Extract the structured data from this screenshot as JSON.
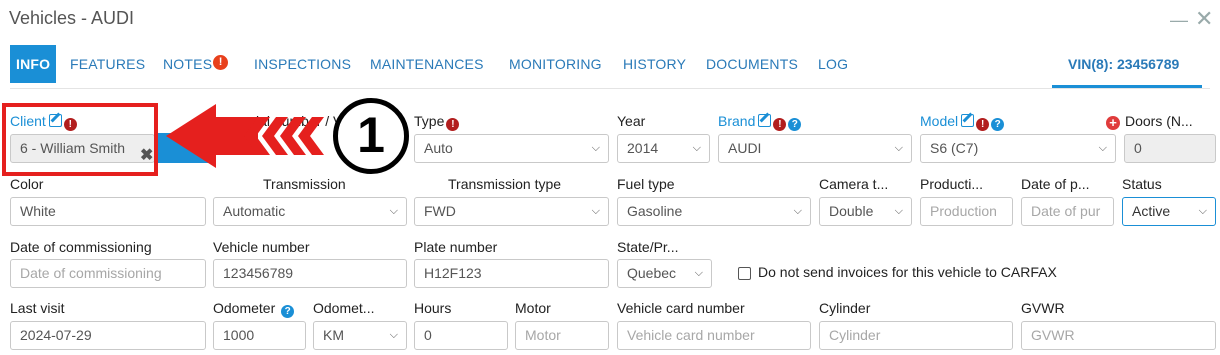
{
  "window": {
    "title": "Vehicles - AUDI",
    "minimize": "—",
    "close": "✕"
  },
  "tabs": [
    {
      "label": "INFO",
      "active": true
    },
    {
      "label": "FEATURES"
    },
    {
      "label": "NOTES",
      "badge": "!"
    },
    {
      "label": "INSPECTIONS"
    },
    {
      "label": "MAINTENANCES"
    },
    {
      "label": "MONITORING"
    },
    {
      "label": "HISTORY"
    },
    {
      "label": "DOCUMENTS"
    },
    {
      "label": "LOG"
    }
  ],
  "vin_tab": "VIN(8): 23456789",
  "icons": {
    "required": "!",
    "help": "?",
    "add": "+",
    "remove": "✖",
    "chevron": "⌵"
  },
  "labels": {
    "client": "Client",
    "serial": "ial number / VI",
    "type": "Type",
    "year": "Year",
    "brand": "Brand",
    "model": "Model",
    "doors": "Doors (N...",
    "color": "Color",
    "transmission": "Transmission",
    "transmission_type": "Transmission type",
    "fuel_type": "Fuel type",
    "camera": "Camera t...",
    "production": "Producti...",
    "date_purchase": "Date of p...",
    "status": "Status",
    "date_commissioning": "Date of commissioning",
    "vehicle_number": "Vehicle number",
    "plate_number": "Plate number",
    "state": "State/Pr...",
    "last_visit": "Last visit",
    "odometer": "Odometer",
    "odometer_unit": "Odomet...",
    "hours": "Hours",
    "motor": "Motor",
    "vehicle_card": "Vehicle card number",
    "cylinder": "Cylinder",
    "gvwr": "GVWR"
  },
  "values": {
    "client": "6 - William Smith",
    "type": "Auto",
    "year": "2014",
    "brand": "AUDI",
    "model": "S6 (C7)",
    "doors": "0",
    "color": "White",
    "transmission": "Automatic",
    "transmission_type": "FWD",
    "fuel_type": "Gasoline",
    "camera": "Double",
    "status": "Active",
    "vehicle_number": "123456789",
    "plate_number": "H12F123",
    "state": "Quebec",
    "last_visit": "2024-07-29",
    "odometer": "1000",
    "odometer_unit": "KM",
    "hours": "0"
  },
  "placeholders": {
    "production": "Production",
    "date_purchase": "Date of pur",
    "date_commissioning": "Date of commissioning",
    "motor": "Motor",
    "vehicle_card": "Vehicle card number",
    "cylinder": "Cylinder",
    "gvwr": "GVWR"
  },
  "checkbox": {
    "label": "Do not send invoices for this vehicle to CARFAX",
    "checked": false
  },
  "annotation": {
    "number": "1"
  },
  "colors": {
    "accent": "#1a8fd6",
    "required": "#b21e1e",
    "annotation_red": "#e5201e"
  }
}
